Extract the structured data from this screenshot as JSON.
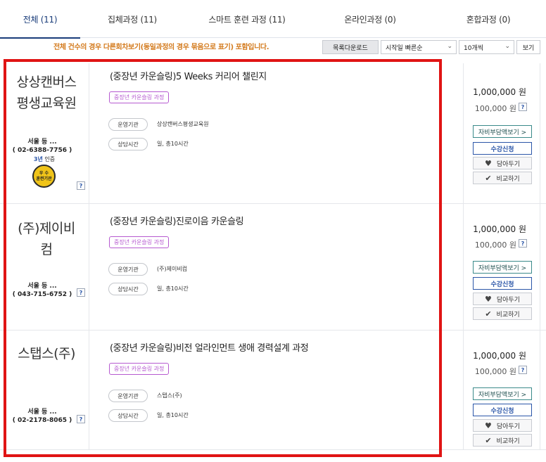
{
  "tabs": [
    {
      "label": "전체 (11)"
    },
    {
      "label": "집체과정 (11)"
    },
    {
      "label": "스마트 훈련 과정 (11)"
    },
    {
      "label": "온라인과정 (0)"
    },
    {
      "label": "혼합과정 (0)"
    }
  ],
  "toolbar": {
    "notice": "전체 건수의 경우 다른회차보기(동일과정의 경우 묶음으로 표기) 포함입니다.",
    "download_label": "목록다운로드",
    "sort_selected": "시작일 빠른순",
    "count_selected": "10개씩",
    "view_label": "보기"
  },
  "colors": {
    "accent": "#1a3d7a",
    "notice": "#d37a1c",
    "tag": "#b65ad0",
    "highlight": "#e01414"
  },
  "rows": [
    {
      "org_name_line1": "상상캔버스",
      "org_name_line2": "평생교육원",
      "contact_region": "서울 등 ...",
      "contact_phone": "( 02-6388-7756 )",
      "cert_years": "3년",
      "cert_label": "인증",
      "badge_top": "우 수",
      "badge_bottom": "훈련기관",
      "help": "?",
      "title": "(중장년 카운슬링)5 Weeks 커리어 챌린지",
      "tag": "중장년 카운슬링 과정",
      "org_pill": "운영기관",
      "org_value": "상상캔버스평생교육원",
      "time_pill": "상담시간",
      "time_value": "일, 총10시간",
      "price": "1,000,000 원",
      "price_sub": "100,000 원",
      "support": "자비부담액보기 >",
      "apply": "수강신청",
      "save": "담아두기",
      "compare": "비교하기"
    },
    {
      "org_name_line1": "(주)제이비",
      "org_name_line2": "컴",
      "contact_region": "서울 등 ...",
      "contact_phone": "( 043-715-6752 )",
      "help": "?",
      "title": "(중장년 카운슬링)진로이음 카운슬링",
      "tag": "중장년 카운슬링 과정",
      "org_pill": "운영기관",
      "org_value": "(주)제이비컴",
      "time_pill": "상담시간",
      "time_value": "일, 총10시간",
      "price": "1,000,000 원",
      "price_sub": "100,000 원",
      "support": "자비부담액보기 >",
      "apply": "수강신청",
      "save": "담아두기",
      "compare": "비교하기"
    },
    {
      "org_name_line1": "스탭스(주)",
      "contact_region": "서울 등 ...",
      "contact_phone": "( 02-2178-8065 )",
      "help": "?",
      "title": "(중장년 카운슬링)비전 얼라인먼트 생애 경력설계 과정",
      "tag": "중장년 카운슬링 과정",
      "org_pill": "운영기관",
      "org_value": "스탭스(주)",
      "time_pill": "상담시간",
      "time_value": "일, 총10시간",
      "price": "1,000,000 원",
      "price_sub": "100,000 원",
      "support": "자비부담액보기 >",
      "apply": "수강신청",
      "save": "담아두기",
      "compare": "비교하기"
    }
  ],
  "icons": {
    "heart": "heart-icon",
    "check": "check-icon",
    "dropdown": "chevron-down-icon"
  }
}
